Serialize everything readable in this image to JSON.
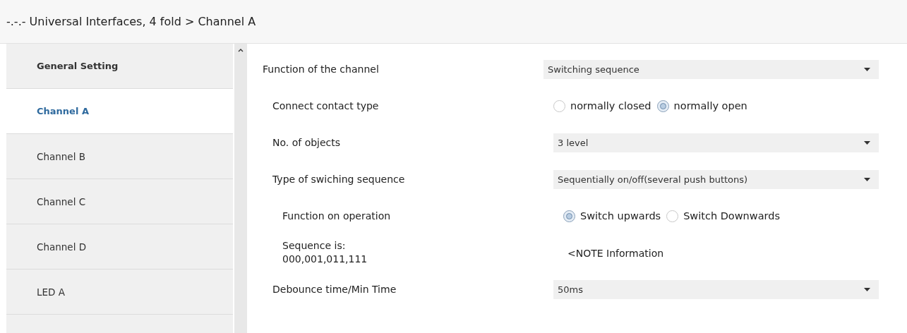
{
  "window": {
    "title": "-.-.- Universal Interfaces, 4 fold > Channel A"
  },
  "sidebar": {
    "items": [
      {
        "label": "General Setting",
        "selected": false,
        "bold": true
      },
      {
        "label": "Channel A",
        "selected": true,
        "bold": true
      },
      {
        "label": "Channel B",
        "selected": false,
        "bold": false
      },
      {
        "label": "Channel C",
        "selected": false,
        "bold": false
      },
      {
        "label": "Channel D",
        "selected": false,
        "bold": false
      },
      {
        "label": "LED A",
        "selected": false,
        "bold": false
      }
    ]
  },
  "parameters": [
    {
      "label": "Function of the channel",
      "kind": "dropdown",
      "value": "Switching sequence",
      "children": [
        {
          "label": "Connect contact type",
          "kind": "radio",
          "options": [
            {
              "label": "normally closed",
              "selected": false
            },
            {
              "label": "normally open",
              "selected": true
            }
          ]
        },
        {
          "label": "No. of objects",
          "kind": "dropdown",
          "value": "3 level"
        },
        {
          "label": "Type of swiching sequence",
          "kind": "dropdown",
          "value": "Sequentially on/off(several push buttons)",
          "children": [
            {
              "label": "Function on operation",
              "kind": "radio",
              "options": [
                {
                  "label": "Switch upwards",
                  "selected": true
                },
                {
                  "label": "Switch Downwards",
                  "selected": false
                }
              ]
            },
            {
              "label": "Sequence is:\n000,001,011,111",
              "kind": "note",
              "value": "<NOTE Information"
            }
          ]
        },
        {
          "label": "Debounce time/Min Time",
          "kind": "dropdown",
          "value": "50ms"
        }
      ]
    }
  ]
}
